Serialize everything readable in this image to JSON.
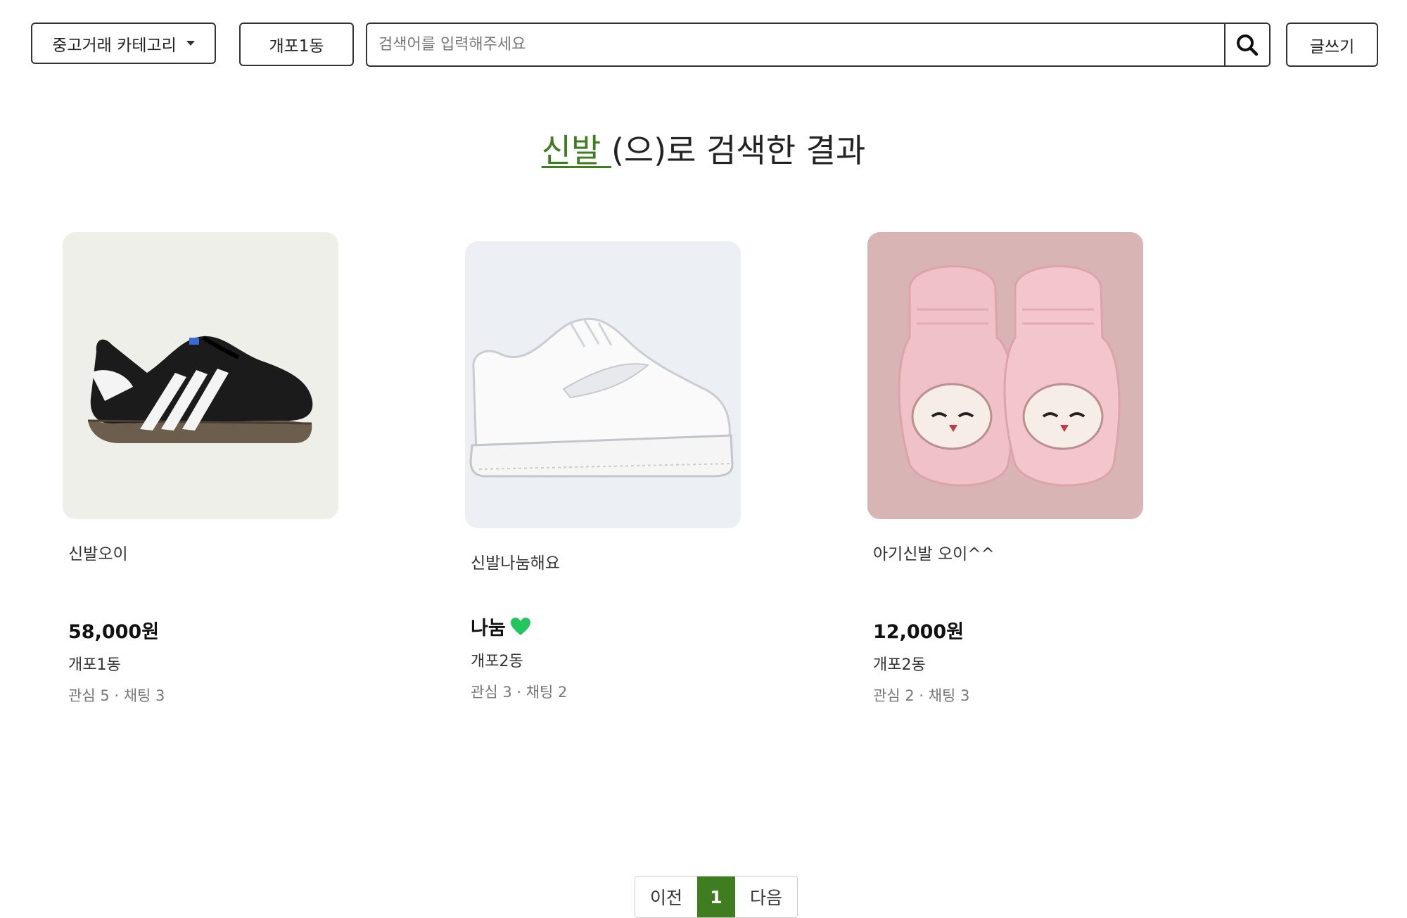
{
  "header": {
    "category_label": "중고거래 카테고리",
    "location_label": "개포1동",
    "search_placeholder": "검색어를 입력해주세요",
    "search_value": "",
    "write_label": "글쓰기"
  },
  "result": {
    "keyword": "신발 ",
    "suffix": "(으)로 검색한 결과"
  },
  "items": [
    {
      "title": "신발오이",
      "price": "58,000원",
      "location": "개포1동",
      "stats": "관심 5 · 채팅 3",
      "image": "black-white-sneaker"
    },
    {
      "title": "신발나눔해요",
      "price": "나눔",
      "location": "개포2동",
      "stats": "관심 3 · 채팅 2",
      "image": "white-sneaker",
      "badge_icon": "green-heart-icon"
    },
    {
      "title": "아기신발 오이^^",
      "price": "12,000원",
      "location": "개포2동",
      "stats": "관심 2 · 채팅 3",
      "image": "pink-baby-booties"
    }
  ],
  "pagination": {
    "prev": "이전",
    "current": "1",
    "next": "다음"
  },
  "colors": {
    "accent": "#3f7d20",
    "heart": "#22c55e"
  }
}
